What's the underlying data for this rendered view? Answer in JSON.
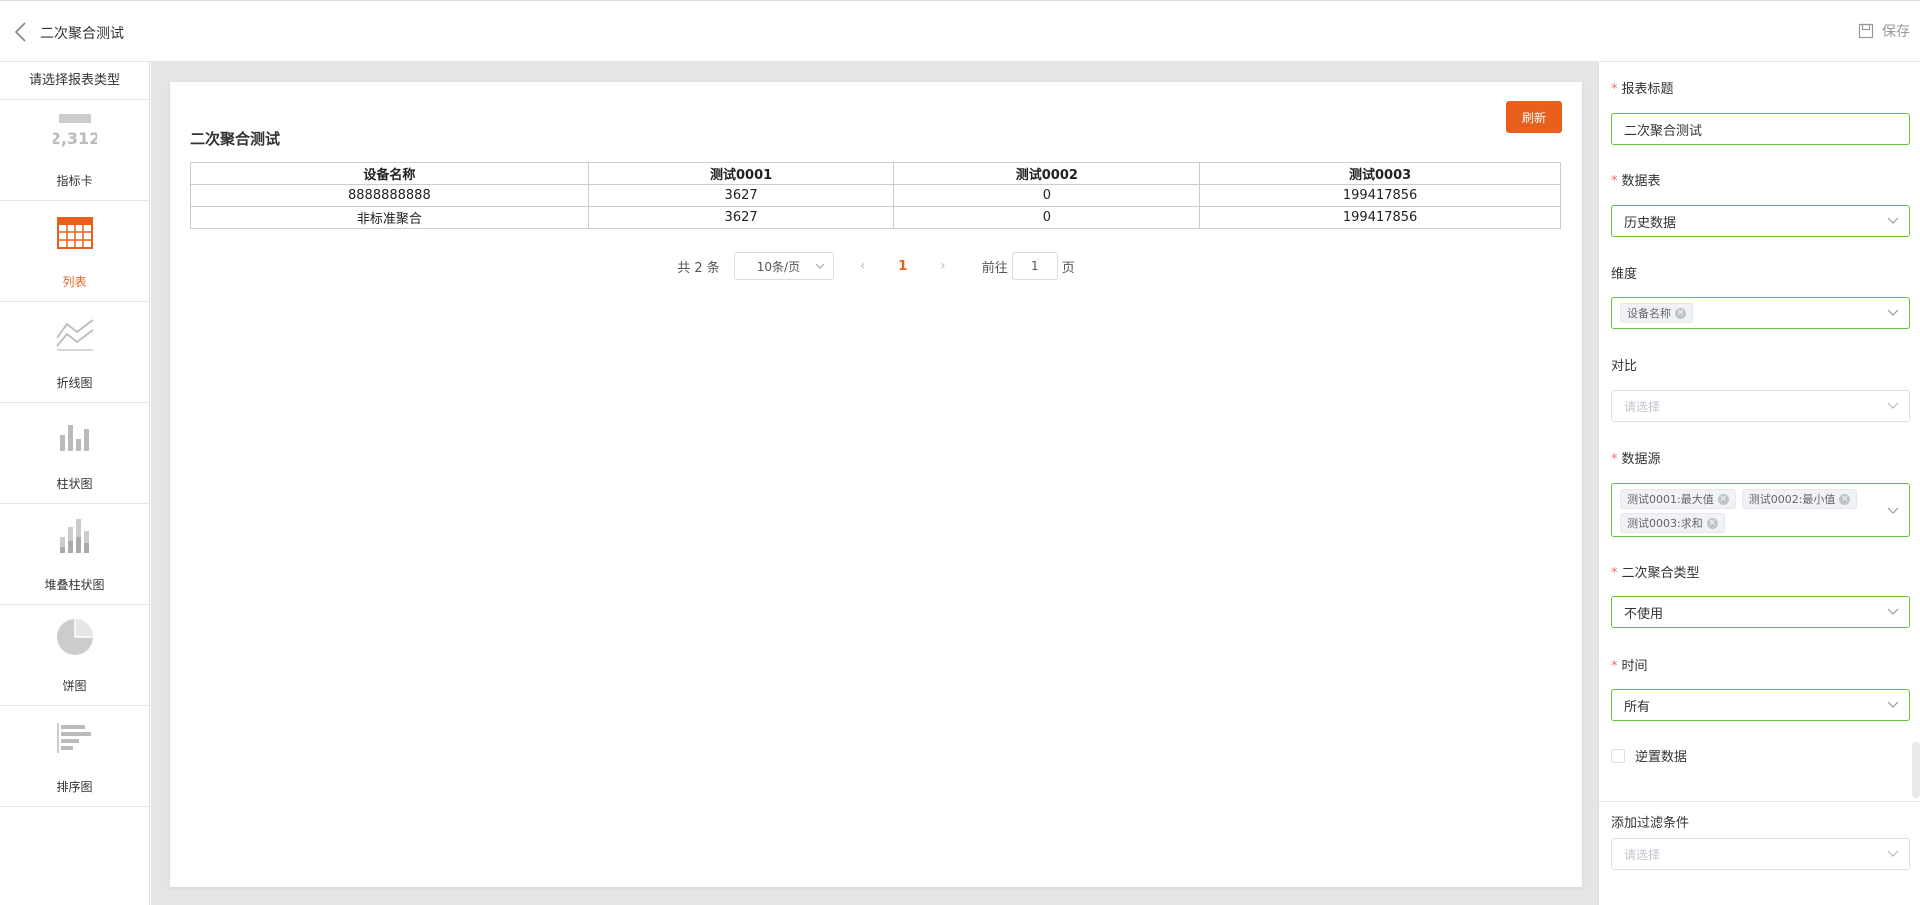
{
  "topbar": {
    "title": "二次聚合测试",
    "save_label": "保存"
  },
  "sidebar": {
    "header": "请选择报表类型",
    "items": [
      {
        "label": "指标卡",
        "icon": "metric-card-icon",
        "icon_text": "2,312",
        "active": false
      },
      {
        "label": "列表",
        "icon": "table-icon",
        "active": true
      },
      {
        "label": "折线图",
        "icon": "line-chart-icon",
        "active": false
      },
      {
        "label": "柱状图",
        "icon": "bar-chart-icon",
        "active": false
      },
      {
        "label": "堆叠柱状图",
        "icon": "stacked-bar-chart-icon",
        "active": false
      },
      {
        "label": "饼图",
        "icon": "pie-chart-icon",
        "active": false
      },
      {
        "label": "排序图",
        "icon": "ranking-chart-icon",
        "active": false
      }
    ]
  },
  "report": {
    "title": "二次聚合测试",
    "refresh_label": "刷新",
    "columns": [
      "设备名称",
      "测试0001",
      "测试0002",
      "测试0003"
    ],
    "rows": [
      [
        "8888888888",
        "3627",
        "0",
        "199417856"
      ],
      [
        "非标准聚合",
        "3627",
        "0",
        "199417856"
      ]
    ]
  },
  "pager": {
    "total": "共 2 条",
    "page_size": "10条/页",
    "prev": "‹",
    "current_page": "1",
    "next": "›",
    "goto_label": "前往",
    "goto_value": "1",
    "page_suffix": "页"
  },
  "form": {
    "report_title_label": "报表标题",
    "report_title_value": "二次聚合测试",
    "datatable_label": "数据表",
    "datatable_value": "历史数据",
    "dimension_label": "维度",
    "dimension_tags": [
      "设备名称"
    ],
    "compare_label": "对比",
    "compare_placeholder": "请选择",
    "datasource_label": "数据源",
    "datasource_tags": [
      "测试0001:最大值",
      "测试0002:最小值",
      "测试0003:求和"
    ],
    "agg_type_label": "二次聚合类型",
    "agg_type_value": "不使用",
    "time_label": "时间",
    "time_value": "所有",
    "transpose_label": "逆置数据",
    "filter_label": "添加过滤条件",
    "filter_placeholder": "请选择",
    "required_mark": "*"
  },
  "colors": {
    "accent": "#e8601c",
    "valid_border": "#67c23a",
    "required": "#f56c6c"
  }
}
